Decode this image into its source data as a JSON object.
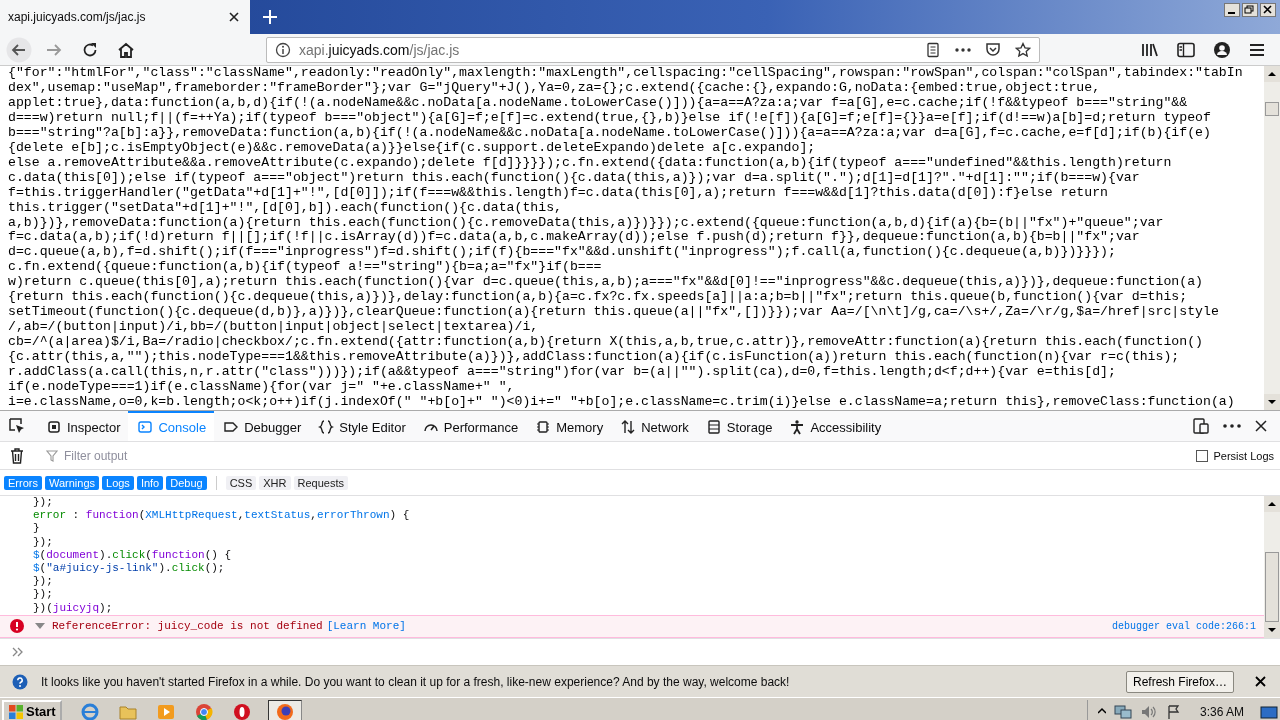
{
  "browser_tab": {
    "title": "xapi.juicyads.com/js/jac.js",
    "selected": true
  },
  "address_bar": {
    "url_parts": [
      {
        "text": "xapi.",
        "kind": "muted"
      },
      {
        "text": "juicyads.com",
        "kind": "domain"
      },
      {
        "text": "/js/jac.js",
        "kind": "muted"
      }
    ]
  },
  "source_lines": [
    "{\"for\":\"htmlFor\",\"class\":\"className\",readonly:\"readOnly\",maxlength:\"maxLength\",cellspacing:\"cellSpacing\",rowspan:\"rowSpan\",colspan:\"colSpan\",tabindex:\"tabIn",
    "dex\",usemap:\"useMap\",frameborder:\"frameBorder\"};var G=\"jQuery\"+J(),Ya=0,za={};c.extend({cache:{},expando:G,noData:{embed:true,object:true,",
    "applet:true},data:function(a,b,d){if(!(a.nodeName&&c.noData[a.nodeName.toLowerCase()])){a=a==A?za:a;var f=a[G],e=c.cache;if(!f&&typeof b===\"string\"&&",
    "d===w)return null;f||(f=++Ya);if(typeof b===\"object\"){a[G]=f;e[f]=c.extend(true,{},b)}else if(!e[f]){a[G]=f;e[f]={}}a=e[f];if(d!==w)a[b]=d;return typeof",
    "b===\"string\"?a[b]:a}},removeData:function(a,b){if(!(a.nodeName&&c.noData[a.nodeName.toLowerCase()])){a=a==A?za:a;var d=a[G],f=c.cache,e=f[d];if(b){if(e)",
    "{delete e[b];c.isEmptyObject(e)&&c.removeData(a)}}else{if(c.support.deleteExpando)delete a[c.expando];",
    "else a.removeAttribute&&a.removeAttribute(c.expando);delete f[d]}}}});c.fn.extend({data:function(a,b){if(typeof a===\"undefined\"&&this.length)return",
    "c.data(this[0]);else if(typeof a===\"object\")return this.each(function(){c.data(this,a)});var d=a.split(\".\");d[1]=d[1]?\".\"+d[1]:\"\";if(b===w){var",
    "f=this.triggerHandler(\"getData\"+d[1]+\"!\",[d[0]]);if(f===w&&this.length)f=c.data(this[0],a);return f===w&&d[1]?this.data(d[0]):f}else return",
    "this.trigger(\"setData\"+d[1]+\"!\",[d[0],b]).each(function(){c.data(this,",
    "a,b)})},removeData:function(a){return this.each(function(){c.removeData(this,a)})}});c.extend({queue:function(a,b,d){if(a){b=(b||\"fx\")+\"queue\";var",
    "f=c.data(a,b);if(!d)return f||[];if(!f||c.isArray(d))f=c.data(a,b,c.makeArray(d));else f.push(d);return f}},dequeue:function(a,b){b=b||\"fx\";var",
    "d=c.queue(a,b),f=d.shift();if(f===\"inprogress\")f=d.shift();if(f){b===\"fx\"&&d.unshift(\"inprogress\");f.call(a,function(){c.dequeue(a,b)})}}});",
    "c.fn.extend({queue:function(a,b){if(typeof a!==\"string\"){b=a;a=\"fx\"}if(b===",
    "w)return c.queue(this[0],a);return this.each(function(){var d=c.queue(this,a,b);a===\"fx\"&&d[0]!==\"inprogress\"&&c.dequeue(this,a)})},dequeue:function(a)",
    "{return this.each(function(){c.dequeue(this,a)})},delay:function(a,b){a=c.fx?c.fx.speeds[a]||a:a;b=b||\"fx\";return this.queue(b,function(){var d=this;",
    "setTimeout(function(){c.dequeue(d,b)},a)})},clearQueue:function(a){return this.queue(a||\"fx\",[])}});var Aa=/[\\n\\t]/g,ca=/\\s+/,Za=/\\r/g,$a=/href|src|style",
    "/,ab=/(button|input)/i,bb=/(button|input|object|select|textarea)/i,",
    "cb=/^(a|area)$/i,Ba=/radio|checkbox/;c.fn.extend({attr:function(a,b){return X(this,a,b,true,c.attr)},removeAttr:function(a){return this.each(function()",
    "{c.attr(this,a,\"\");this.nodeType===1&&this.removeAttribute(a)})},addClass:function(a){if(c.isFunction(a))return this.each(function(n){var r=c(this);",
    "r.addClass(a.call(this,n,r.attr(\"class\")))});if(a&&typeof a===\"string\")for(var b=(a||\"\").split(ca),d=0,f=this.length;d<f;d++){var e=this[d];",
    "if(e.nodeType===1)if(e.className){for(var j=\" \"+e.className+\" \",",
    "i=e.className,o=0,k=b.length;o<k;o++)if(j.indexOf(\" \"+b[o]+\" \")<0)i+=\" \"+b[o];e.className=c.trim(i)}else e.className=a;return this},removeClass:function(a)"
  ],
  "devtools": {
    "tabs": [
      {
        "label": "Inspector",
        "selected": false
      },
      {
        "label": "Console",
        "selected": true
      },
      {
        "label": "Debugger",
        "selected": false
      },
      {
        "label": "Style Editor",
        "selected": false
      },
      {
        "label": "Performance",
        "selected": false
      },
      {
        "label": "Memory",
        "selected": false
      },
      {
        "label": "Network",
        "selected": false
      },
      {
        "label": "Storage",
        "selected": false
      },
      {
        "label": "Accessibility",
        "selected": false
      }
    ],
    "filter": {
      "placeholder": "Filter output"
    },
    "persist_logs": {
      "label": "Persist Logs",
      "checked": false
    },
    "filters": [
      {
        "label": "Errors",
        "selected": true
      },
      {
        "label": "Warnings",
        "selected": true
      },
      {
        "label": "Logs",
        "selected": true
      },
      {
        "label": "Info",
        "selected": true
      },
      {
        "label": "Debug",
        "selected": true
      },
      {
        "label": "CSS",
        "selected": false
      },
      {
        "label": "XHR",
        "selected": false
      },
      {
        "label": "Requests",
        "selected": false
      }
    ]
  },
  "console": {
    "lines": [
      [
        {
          "text": "});",
          "kind": "plain"
        }
      ],
      [
        {
          "text": "error",
          "kind": "prop"
        },
        {
          "text": " : ",
          "kind": "plain"
        },
        {
          "text": "function",
          "kind": "keyword"
        },
        {
          "text": "(",
          "kind": "plain"
        },
        {
          "text": "XMLHttpRequest",
          "kind": "name"
        },
        {
          "text": ",",
          "kind": "plain"
        },
        {
          "text": "textStatus",
          "kind": "name"
        },
        {
          "text": ",",
          "kind": "plain"
        },
        {
          "text": "errorThrown",
          "kind": "name"
        },
        {
          "text": ") {",
          "kind": "plain"
        }
      ],
      [
        {
          "text": "}",
          "kind": "plain"
        }
      ],
      [
        {
          "text": "});",
          "kind": "plain"
        }
      ],
      [
        {
          "text": "$",
          "kind": "name"
        },
        {
          "text": "(",
          "kind": "plain"
        },
        {
          "text": "document",
          "kind": "keyword"
        },
        {
          "text": ").",
          "kind": "plain"
        },
        {
          "text": "click",
          "kind": "prop"
        },
        {
          "text": "(",
          "kind": "plain"
        },
        {
          "text": "function",
          "kind": "keyword"
        },
        {
          "text": "() {",
          "kind": "plain"
        }
      ],
      [
        {
          "text": "$",
          "kind": "name"
        },
        {
          "text": "(",
          "kind": "plain"
        },
        {
          "text": "\"a#juicy-js-link\"",
          "kind": "string"
        },
        {
          "text": ").",
          "kind": "plain"
        },
        {
          "text": "click",
          "kind": "prop"
        },
        {
          "text": "();",
          "kind": "plain"
        }
      ],
      [
        {
          "text": "});",
          "kind": "plain"
        }
      ],
      [
        {
          "text": "});",
          "kind": "plain"
        }
      ],
      [
        {
          "text": "})(",
          "kind": "plain"
        },
        {
          "text": "juicyjq",
          "kind": "keyword"
        },
        {
          "text": ");",
          "kind": "plain"
        }
      ]
    ],
    "error": {
      "message": "ReferenceError: juicy_code is not defined",
      "link": "[Learn More]",
      "location": "debugger eval code:266:1",
      "expanded": true
    }
  },
  "notification": {
    "text": "It looks like you haven't started Firefox in a while. Do you want to clean it up for a fresh, like-new experience? And by the way, welcome back!",
    "button": "Refresh Firefox…"
  },
  "taskbar": {
    "start": "Start",
    "time": "3:36 AM"
  }
}
